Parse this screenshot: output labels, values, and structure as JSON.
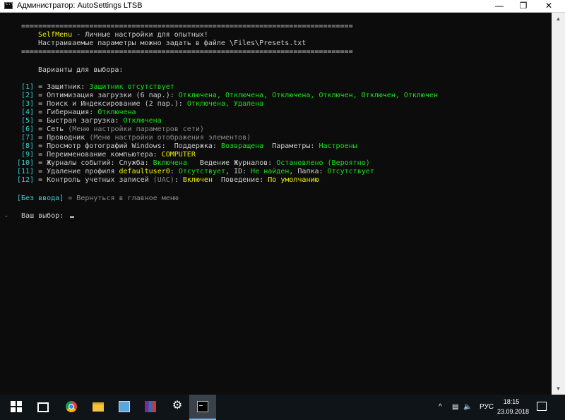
{
  "window": {
    "title": "Администратор:  AutoSettings LTSB",
    "minimize_icon": "minimize-icon",
    "maximize_icon": "maximize-icon",
    "close_icon": "close-icon"
  },
  "console": {
    "separator": "==============================================================================",
    "header_line1_name": "SelfMenu",
    "header_line1_rest": " - Личные настройки для опытных!",
    "header_line2": "Настраиваемые параметры можно задать в файле \\Files\\Presets.txt",
    "choose_heading": "Варианты для выбора:",
    "items": [
      {
        "num": "[1]",
        "label": " = Защитник: ",
        "status1": "Защитник отсутствует"
      },
      {
        "num": "[2]",
        "label": " = Оптимизация загрузки (6 пар.): ",
        "status1": "Отключена, Отключена, Отключена, Отключен, Отключен, Отключен"
      },
      {
        "num": "[3]",
        "label": " = Поиск и Индексирование (2 пар.): ",
        "status1": "Отключена, Удалена"
      },
      {
        "num": "[4]",
        "label": " = Гибернация: ",
        "status1": "Отключена"
      },
      {
        "num": "[5]",
        "label": " = Быстрая загрузка: ",
        "status1": "Отключена"
      },
      {
        "num": "[6]",
        "label": " = Сеть ",
        "note": "(Меню настройки параметров сети)"
      },
      {
        "num": "[7]",
        "label": " = Проводник ",
        "note": "(Меню настройки отображения элементов)"
      },
      {
        "num": "[8]",
        "label": " = Просмотр фотографий Windows:  Поддержка: ",
        "status1": "Возвращена",
        "label2": "  Параметры: ",
        "status2": "Настроены"
      },
      {
        "num": "[9]",
        "label": " = Переименование компьютера: ",
        "value": "COMPUTER"
      },
      {
        "num": "[10]",
        "label": " = Журналы событий: Служба: ",
        "status1": "Включена",
        "label2": "   Ведение Журналов: ",
        "status2": "Остановлено (Вероятно)"
      },
      {
        "num": "[11]",
        "label": " = Удаление профиля ",
        "value": "defaultuser0",
        "label2": ": ",
        "status1": "Отсутствует",
        "label3": ", ID: ",
        "status2": "Не найден",
        "label4": ", Папка: ",
        "status3": "Отсутствует"
      },
      {
        "num": "[12]",
        "label": " = Контроль учетных записей ",
        "note": "(UAC)",
        "label2": ": ",
        "value": "Включен",
        "label3": "  Поведение: ",
        "value2": "По умолчанию"
      }
    ],
    "no_input_key": "[Без ввода]",
    "no_input_text": " = Вернуться в главное меню",
    "prompt_dash": "-",
    "prompt": "Ваш выбор: "
  },
  "taskbar": {
    "icons": [
      "windows-start-icon",
      "task-view-icon",
      "chrome-icon",
      "file-explorer-icon",
      "control-panel-icon",
      "winrar-icon",
      "settings-gear-icon",
      "command-prompt-icon"
    ],
    "tray_chevron": "^",
    "language": "РУС",
    "time": "18:15",
    "date": "23.09.2018"
  },
  "colors": {
    "console_bg": "#0c0c0c",
    "yellow": "#f0f000",
    "green": "#16e316",
    "cyan": "#3ad1d1",
    "gray": "#8a8a8a",
    "taskbar": "#0e1418",
    "active_indicator": "#76b9ed"
  }
}
